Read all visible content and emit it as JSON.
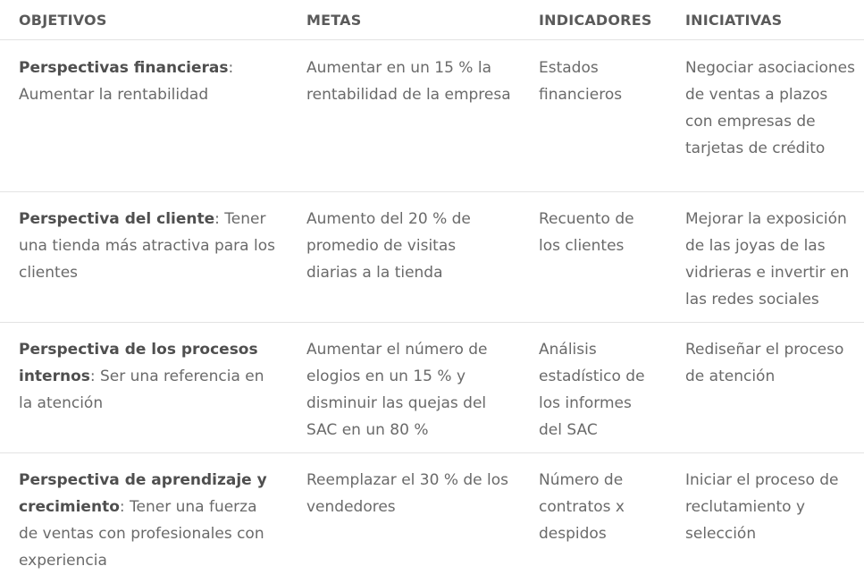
{
  "headers": {
    "objetivos": "OBJETIVOS",
    "metas": "METAS",
    "indicadores": "INDICADORES",
    "iniciativas": "INICIATIVAS"
  },
  "rows": [
    {
      "objetivo_lead": "Perspectivas financieras",
      "objetivo_rest": ": Aumentar la rentabilidad",
      "meta": "Aumentar en un 15 % la rentabilidad de la empresa",
      "indicador": "Estados financieros",
      "iniciativa": "Negociar asociaciones de ventas a plazos con empresas de tarjetas de crédito"
    },
    {
      "objetivo_lead": "Perspectiva del cliente",
      "objetivo_rest": ": Tener una tienda más atractiva para los clientes",
      "meta": "Aumento del 20 % de promedio de visitas diarias a la tienda",
      "indicador": "Recuento de los clientes",
      "iniciativa": "Mejorar la exposición de las joyas de las vidrieras e invertir en las redes sociales"
    },
    {
      "objetivo_lead": "Perspectiva de los procesos internos",
      "objetivo_rest": ": Ser una referencia en la atención",
      "meta": "Aumentar el número de elogios en un 15 % y disminuir las quejas del SAC en un 80 %",
      "indicador": "Análisis estadístico de los informes del SAC",
      "iniciativa": "Rediseñar el proceso de atención"
    },
    {
      "objetivo_lead": "Perspectiva de aprendizaje y crecimiento",
      "objetivo_rest": ": Tener una fuerza de ventas con profesionales con experiencia",
      "meta": "Reemplazar el 30 % de los vendedores",
      "indicador": "Número de contratos x despidos",
      "iniciativa": "Iniciar el proceso de reclutamiento y selección"
    }
  ]
}
